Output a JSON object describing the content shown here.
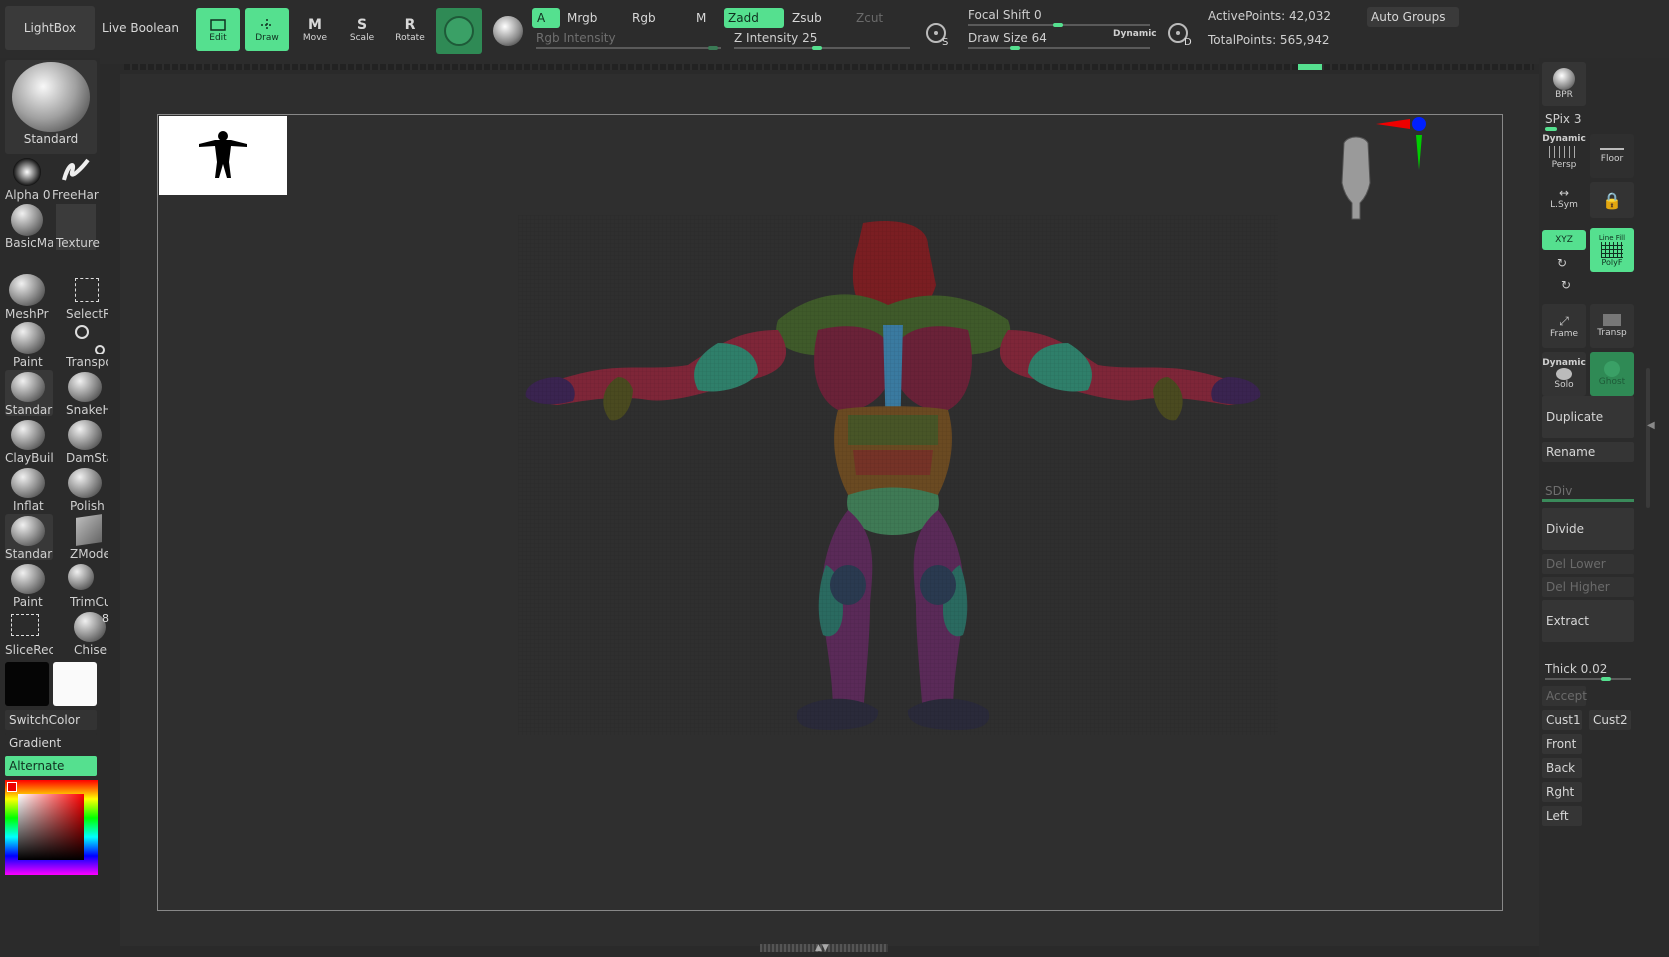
{
  "top": {
    "lightbox": "LightBox",
    "live_boolean": "Live Boolean",
    "edit": "Edit",
    "draw": "Draw",
    "move": "Move",
    "scale": "Scale",
    "rotate": "Rotate",
    "a": "A",
    "mrgb": "Mrgb",
    "rgb": "Rgb",
    "m": "M",
    "zadd": "Zadd",
    "zsub": "Zsub",
    "zcut": "Zcut",
    "rgb_intensity": "Rgb Intensity",
    "z_intensity_label": "Z Intensity",
    "z_intensity_value": "25",
    "focal_shift_label": "Focal Shift",
    "focal_shift_value": "0",
    "draw_size_label": "Draw Size",
    "draw_size_value": "64",
    "dynamic": "Dynamic",
    "s": "S",
    "d": "D",
    "active_points": "ActivePoints: 42,032",
    "total_points": "TotalPoints: 565,942",
    "auto_groups": "Auto Groups"
  },
  "left": {
    "brush": "Standard",
    "alpha": "Alpha 0",
    "stroke": "FreeHar",
    "material": "BasicMa",
    "texture": "Texture",
    "tools": [
      "MeshPr",
      "SelectRe",
      "Paint",
      "Transpo",
      "Standar",
      "SnakeHo",
      "ClayBuil",
      "DamSta",
      "Inflat",
      "Polish",
      "Standar",
      "ZModele",
      "Paint",
      "TrimCur",
      "SliceRec",
      "Chisel"
    ],
    "chisel_count": "8",
    "switch_color": "SwitchColor",
    "gradient": "Gradient",
    "alternate": "Alternate"
  },
  "right": {
    "bpr": "BPR",
    "spix": "SPix 3",
    "dynamic": "Dynamic",
    "persp": "Persp",
    "floor": "Floor",
    "lsym": "L.Sym",
    "xyz": "XYZ",
    "polyf": "PolyF",
    "line_fill": "Line Fill",
    "frame": "Frame",
    "transp": "Transp",
    "dynamic2": "Dynamic",
    "solo": "Solo",
    "ghost": "Ghost",
    "duplicate": "Duplicate",
    "rename": "Rename",
    "sdiv": "SDiv",
    "divide": "Divide",
    "del_lower": "Del Lower",
    "del_higher": "Del Higher",
    "extract": "Extract",
    "thick_label": "Thick",
    "thick_value": "0.02",
    "accept": "Accept",
    "cust1": "Cust1",
    "cust2": "Cust2",
    "front": "Front",
    "back": "Back",
    "rght": "Rght",
    "left": "Left"
  },
  "colors": {
    "accent": "#55e08f",
    "background": "#2a2a2a"
  }
}
